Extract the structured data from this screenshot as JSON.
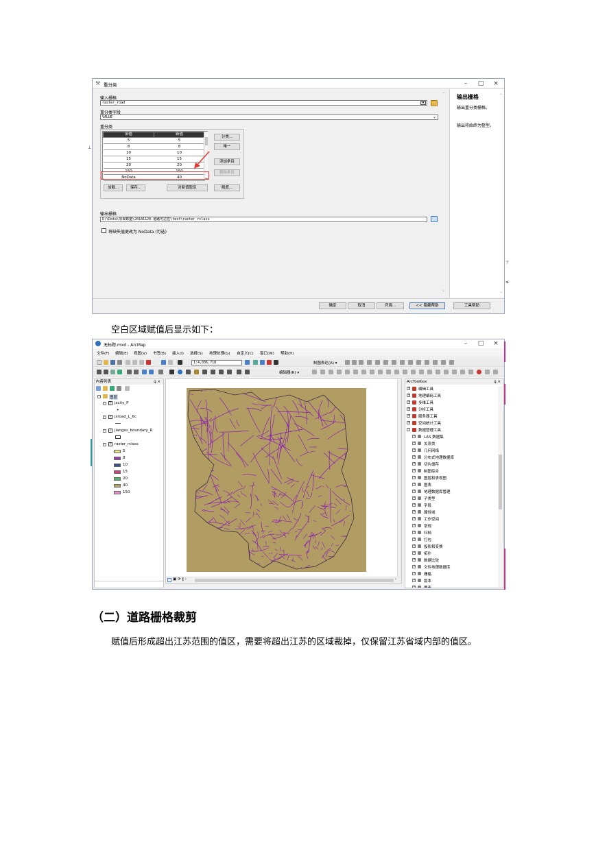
{
  "dialog": {
    "title": "重分类",
    "help_title": "输出栅格",
    "help_text_1": "输出重分类栅格。",
    "help_text_2": "输出将始终为整型。",
    "input_raster_label": "输入栅格",
    "input_raster_value": "raster_road",
    "reclass_field_label": "重分类字段",
    "reclass_field_value": "VALUE",
    "reclass_label": "重分类",
    "table_headers": [
      "旧值",
      "新值"
    ],
    "table_rows": [
      {
        "old": "5",
        "new": "5"
      },
      {
        "old": "8",
        "new": "8"
      },
      {
        "old": "10",
        "new": "10"
      },
      {
        "old": "15",
        "new": "15"
      },
      {
        "old": "20",
        "new": "20"
      },
      {
        "old": "150",
        "new": "150"
      },
      {
        "old": "NoData",
        "new": "40"
      }
    ],
    "btn_classify": "分类...",
    "btn_unique": "唯一",
    "btn_add_entry": "添加条目",
    "btn_delete_entry": "删除条目",
    "btn_load": "加载...",
    "btn_save": "保存...",
    "btn_reverse": "对新值取反",
    "btn_precision": "精度...",
    "output_raster_label": "输出栅格",
    "output_raster_value": "D:\\Data\\项目数据\\20181120-道路可达性\\test\\raster_rclass",
    "missing_nodata_label": "将缺失值更改为 NoData (可选)",
    "footer_ok": "确定",
    "footer_cancel": "取消",
    "footer_env": "环境...",
    "footer_hide_help": "<< 隐藏帮助",
    "footer_tool_help": "工具帮助"
  },
  "caption_1": "空白区域赋值后显示如下：",
  "arcmap": {
    "title": "无标题.mxd - ArcMap",
    "menu": [
      "文件(F)",
      "编辑(E)",
      "视图(V)",
      "书签(B)",
      "插入(I)",
      "选择(S)",
      "地理处理(G)",
      "自定义(C)",
      "窗口(W)",
      "帮助(H)"
    ],
    "scale": "1:4,036,718",
    "layout_label": "制图表达(A) ▾",
    "editor_label": "编辑器(R) ▾",
    "toc_title": "内容列表",
    "toc_layers": "图层",
    "layer_1": "jscity_P",
    "layer_2": "jsroad_L_6c",
    "layer_3": "jiangsu_boundary_R",
    "layer_4": "raster_rclass",
    "legend": [
      {
        "label": "5",
        "color": "#e6de7e"
      },
      {
        "label": "8",
        "color": "#9b3bb0"
      },
      {
        "label": "10",
        "color": "#3a4f8a"
      },
      {
        "label": "15",
        "color": "#d43f7a"
      },
      {
        "label": "20",
        "color": "#4fb36b"
      },
      {
        "label": "40",
        "color": "#b5a06a"
      },
      {
        "label": "150",
        "color": "#e48fd0"
      }
    ],
    "toolbox_title": "ArcToolbox",
    "toolbox_items": [
      "编辑工具",
      "地理编码工具",
      "多维工具",
      "分析工具",
      "服务器工具",
      "空间统计工具",
      "数据管理工具"
    ],
    "toolbox_sub": [
      "LAS 数据集",
      "关系类",
      "几何网络",
      "分布式地理数据库",
      "切片缓存",
      "制图综合",
      "图层和表视图",
      "图表",
      "地理数据库管理",
      "子类型",
      "字段",
      "属性域",
      "工作空间",
      "常规",
      "归档",
      "打包",
      "投影和变换",
      "拓扑",
      "数据比较",
      "文件地理数据库",
      "栅格",
      "版本",
      "要素"
    ],
    "map_bg": "#b19d63",
    "road_color": "#8a1fb0"
  },
  "heading": "（二）道路栅格裁剪",
  "paragraph": "赋值后形成超出江苏范围的值区，需要将超出江苏的区域裁掉，仅保留江苏省域内部的值区。"
}
